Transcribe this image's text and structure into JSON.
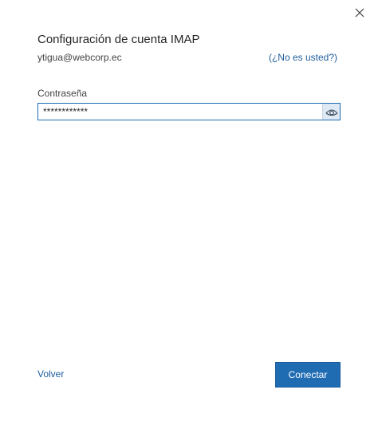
{
  "dialog": {
    "title": "Configuración de cuenta IMAP",
    "email": "ytigua@webcorp.ec",
    "not_you_link": "(¿No es usted?)"
  },
  "password_field": {
    "label": "Contraseña",
    "value": "************"
  },
  "footer": {
    "back_label": "Volver",
    "connect_label": "Conectar"
  },
  "icons": {
    "close": "close-icon",
    "reveal_password": "eye-icon"
  },
  "colors": {
    "accent": "#1f6cb3",
    "link": "#1e5d9c"
  }
}
